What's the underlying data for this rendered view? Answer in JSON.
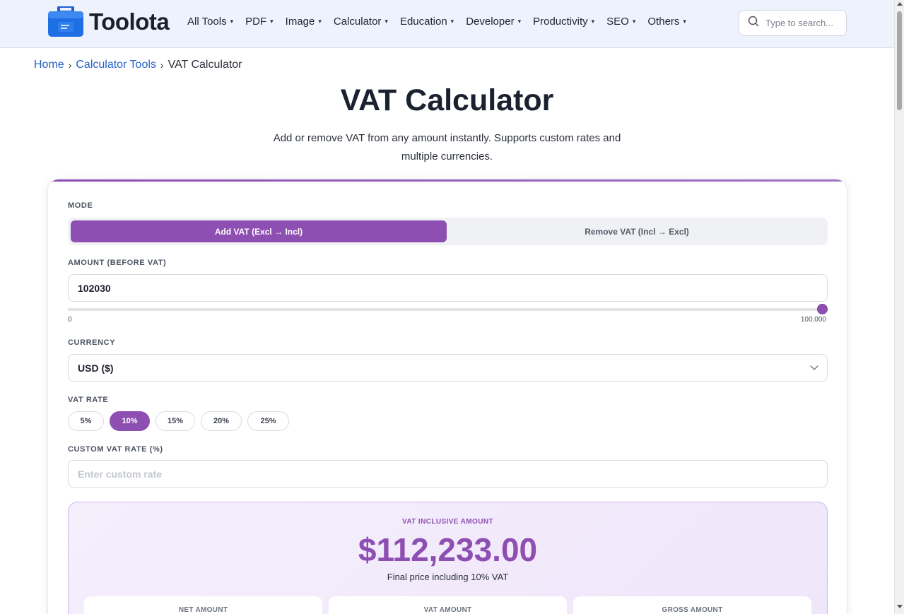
{
  "header": {
    "logo_text": "Toolota",
    "nav": [
      "All Tools",
      "PDF",
      "Image",
      "Calculator",
      "Education",
      "Developer",
      "Productivity",
      "SEO",
      "Others"
    ],
    "search_placeholder": "Type to search..."
  },
  "breadcrumb": {
    "home": "Home",
    "section": "Calculator Tools",
    "current": "VAT Calculator"
  },
  "page": {
    "title": "VAT Calculator",
    "subtitle": "Add or remove VAT from any amount instantly. Supports custom rates and multiple currencies."
  },
  "form": {
    "mode_label": "MODE",
    "mode_add": "Add VAT (Excl → Incl)",
    "mode_remove": "Remove VAT (Incl → Excl)",
    "amount_label": "AMOUNT (BEFORE VAT)",
    "amount_value": "102030",
    "slider_min": "0",
    "slider_max": "100,000",
    "slider_level": 1.0,
    "currency_label": "CURRENCY",
    "currency_value": "USD ($)",
    "vat_rate_label": "VAT RATE",
    "rates": [
      "5%",
      "10%",
      "15%",
      "20%",
      "25%"
    ],
    "selected_rate": "10%",
    "custom_rate_label": "CUSTOM VAT RATE (%)",
    "custom_rate_placeholder": "Enter custom rate"
  },
  "result": {
    "label": "VAT INCLUSIVE AMOUNT",
    "value": "$112,233.00",
    "description": "Final price including 10% VAT",
    "cards": [
      "NET AMOUNT",
      "VAT AMOUNT",
      "GROSS AMOUNT"
    ]
  },
  "colors": {
    "accent": "#8e4fb2",
    "link": "#2563c9",
    "header_bg": "#eef2fc"
  }
}
